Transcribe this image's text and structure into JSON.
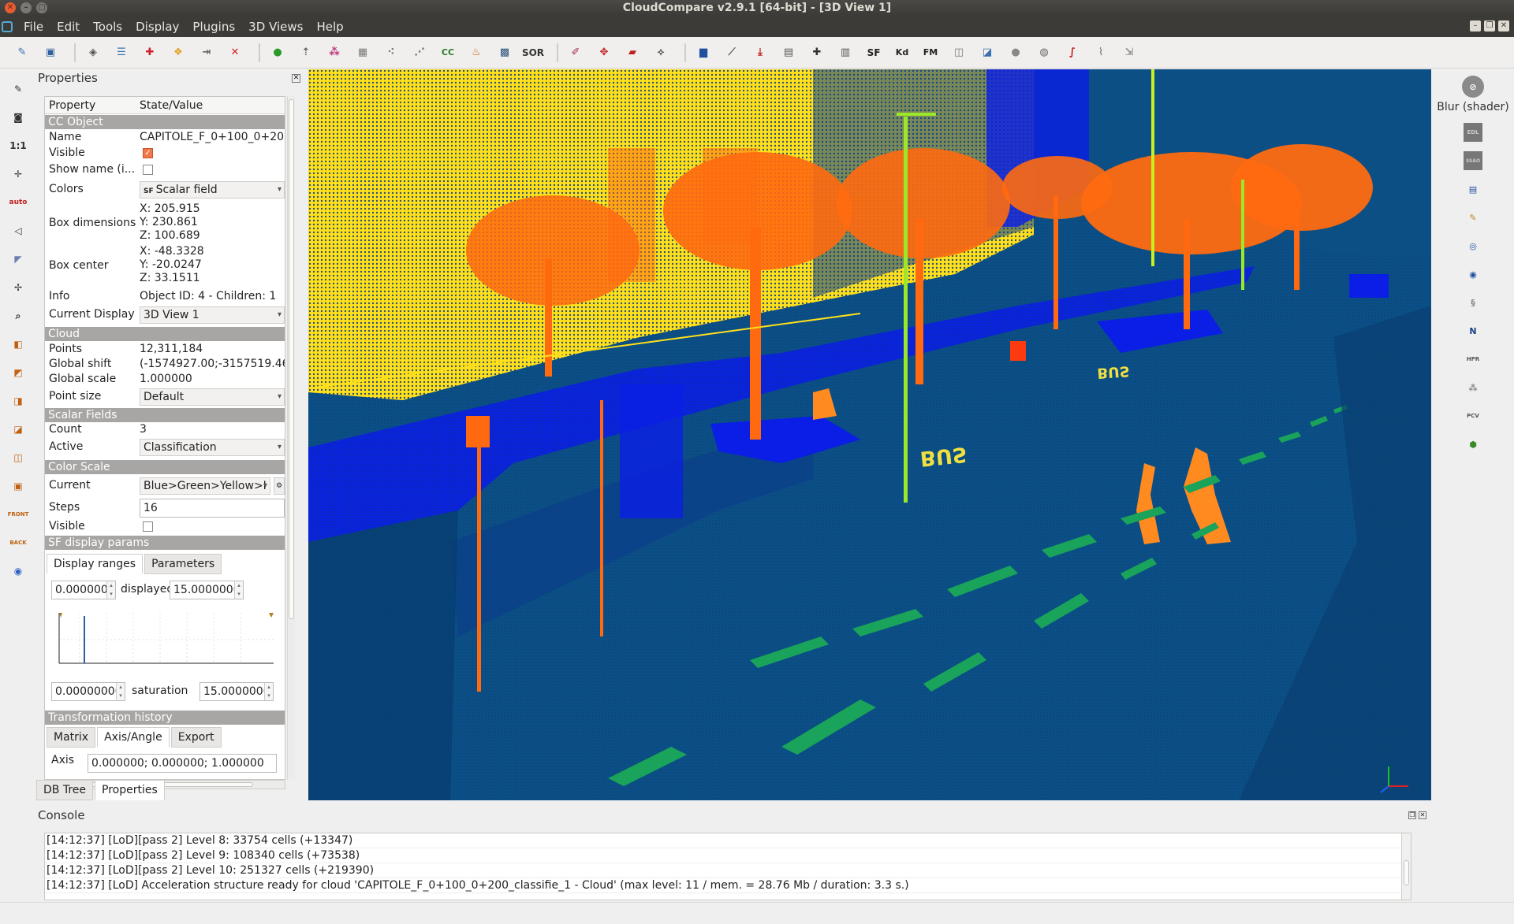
{
  "window": {
    "title": "CloudCompare v2.9.1 [64-bit] - [3D View 1]"
  },
  "menu": {
    "items": [
      "File",
      "Edit",
      "Tools",
      "Display",
      "Plugins",
      "3D Views",
      "Help"
    ]
  },
  "toolbar": {
    "sf_label": "SF",
    "sor_label": "SOR",
    "cc_label": "CC",
    "kd_label": "Kd",
    "fm_label": "FM"
  },
  "left_tools": {
    "scale_label": "1:1",
    "auto_label": "auto",
    "front_label": "FRONT",
    "back_label": "BACK"
  },
  "properties": {
    "title": "Properties",
    "header": {
      "property": "Property",
      "state_value": "State/Value"
    },
    "sections": {
      "cc_object": "CC Object",
      "cloud": "Cloud",
      "scalar_fields": "Scalar Fields",
      "color_scale": "Color Scale",
      "sf_display_params": "SF display params",
      "transformation_history": "Transformation history"
    },
    "name": {
      "label": "Name",
      "value": "CAPITOLE_F_0+100_0+20..."
    },
    "visible": {
      "label": "Visible",
      "checked": true
    },
    "show_name": {
      "label": "Show name (i...",
      "checked": false
    },
    "colors": {
      "label": "Colors",
      "value": "Scalar field",
      "icon": "SF"
    },
    "box_dimensions": {
      "label": "Box dimensions",
      "x": "X: 205.915",
      "y": "Y: 230.861",
      "z": "Z: 100.689"
    },
    "box_center": {
      "label": "Box center",
      "x": "X: -48.3328",
      "y": "Y: -20.0247",
      "z": "Z: 33.1511"
    },
    "info": {
      "label": "Info",
      "value": "Object ID: 4 - Children: 1"
    },
    "current_display": {
      "label": "Current Display",
      "value": "3D View 1"
    },
    "points": {
      "label": "Points",
      "value": "12,311,184"
    },
    "global_shift": {
      "label": "Global shift",
      "value": "(-1574927.00;-3157519.46..."
    },
    "global_scale": {
      "label": "Global scale",
      "value": "1.000000"
    },
    "point_size": {
      "label": "Point size",
      "value": "Default"
    },
    "count": {
      "label": "Count",
      "value": "3"
    },
    "active": {
      "label": "Active",
      "value": "Classification"
    },
    "current_scale": {
      "label": "Current",
      "value": "Blue>Green>Yellow>I"
    },
    "steps": {
      "label": "Steps",
      "value": "16"
    },
    "scale_visible": {
      "label": "Visible",
      "checked": false
    },
    "sf_tabs": [
      "Display ranges",
      "Parameters"
    ],
    "displayed": {
      "min": "0.0000000(",
      "label": "displayed",
      "max": "15.00000000"
    },
    "saturation": {
      "min": "0.00000000",
      "label": "saturation",
      "max": "15.0000000("
    },
    "th_tabs": [
      "Matrix",
      "Axis/Angle",
      "Export"
    ],
    "axis_row": {
      "label": "Axis",
      "value": "0.000000; 0.000000; 1.000000"
    }
  },
  "bottom_tabs": [
    "DB Tree",
    "Properties"
  ],
  "right_tools": {
    "blur_label": "Blur (shader)",
    "n_label": "N",
    "hpr_label": "HPR",
    "pcv_label": "PCV",
    "edl_label": "EDL",
    "ssao_label": "SSAO"
  },
  "scene": {
    "bus_text": "BUS"
  },
  "console": {
    "title": "Console",
    "lines": [
      "[14:12:37] [LoD][pass 2] Level 8: 33754 cells (+13347)",
      "[14:12:37] [LoD][pass 2] Level 9: 108340 cells (+73538)",
      "[14:12:37] [LoD][pass 2] Level 10: 251327 cells (+219390)",
      "[14:12:37] [LoD] Acceleration structure ready for cloud 'CAPITOLE_F_0+100_0+200_classifie_1 - Cloud' (max level: 11 / mem. = 28.76 Mb / duration: 3.3 s.)"
    ]
  },
  "colors": {
    "class_ground": "#0b4f86",
    "class_low": "#0a1ee6",
    "class_building": "#ffe01a",
    "class_veg": "#ff6a10",
    "road_marking": "#1aa35a"
  }
}
